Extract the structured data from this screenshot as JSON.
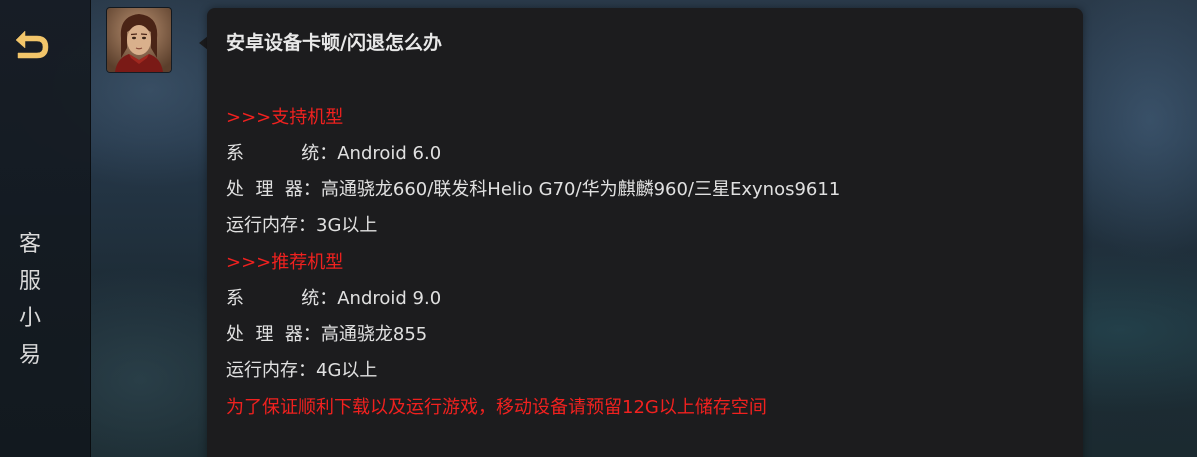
{
  "sidebar": {
    "back_icon": "back-arrow-icon",
    "title_chars": [
      "客",
      "服",
      "小",
      "易"
    ]
  },
  "chat": {
    "avatar_icon": "agent-avatar",
    "message": {
      "title": "安卓设备卡顿/闪退怎么办",
      "lines": [
        {
          "text": ">>>支持机型",
          "color": "#f0211f"
        },
        {
          "text": "系          统：Android 6.0",
          "color": "#e0e0e0"
        },
        {
          "text": "处  理  器：高通骁龙660/联发科Helio G70/华为麒麟960/三星Exynos9611",
          "color": "#e0e0e0"
        },
        {
          "text": "运行内存：3G以上",
          "color": "#e0e0e0"
        },
        {
          "text": ">>>推荐机型",
          "color": "#f0211f"
        },
        {
          "text": "系          统：Android 9.0",
          "color": "#e0e0e0"
        },
        {
          "text": "处  理  器：高通骁龙855",
          "color": "#e0e0e0"
        },
        {
          "text": "运行内存：4G以上",
          "color": "#e0e0e0"
        },
        {
          "text": "为了保证顺利下载以及运行游戏，移动设备请预留12G以上储存空间",
          "color": "#f0211f"
        }
      ]
    }
  },
  "colors": {
    "accent_gold": "#f2c56a",
    "warning_red": "#f0211f",
    "bubble_bg": "#1c1c1e"
  }
}
